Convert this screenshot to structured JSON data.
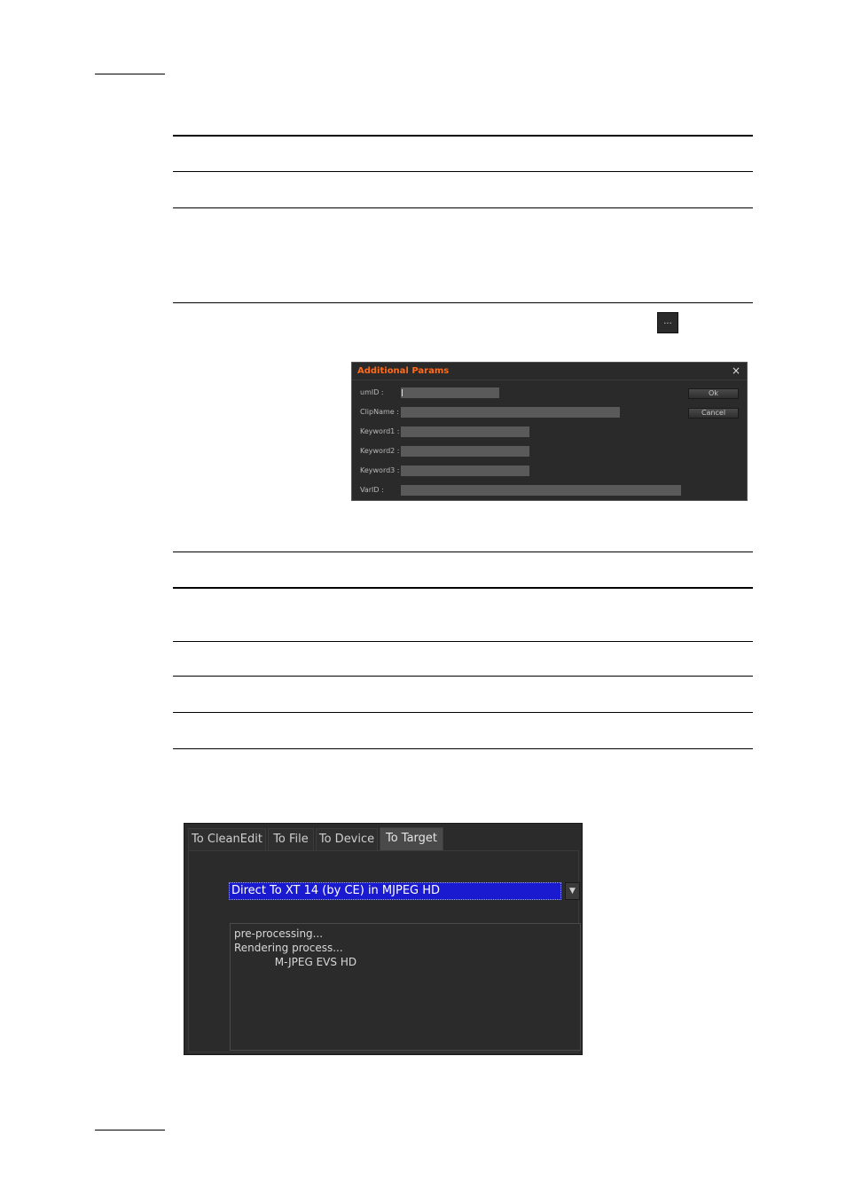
{
  "ellipsis_button": {
    "label": "..."
  },
  "additional_params_dialog": {
    "title": "Additional Params",
    "close_glyph": "×",
    "fields": [
      {
        "label": "umID :",
        "value": ""
      },
      {
        "label": "ClipName :",
        "value": ""
      },
      {
        "label": "Keyword1 :",
        "value": ""
      },
      {
        "label": "Keyword2 :",
        "value": ""
      },
      {
        "label": "Keyword3 :",
        "value": ""
      },
      {
        "label": "VarID :",
        "value": ""
      }
    ],
    "buttons": {
      "ok": "Ok",
      "cancel": "Cancel"
    }
  },
  "output_panel": {
    "tabs": [
      {
        "label": "To CleanEdit",
        "active": false
      },
      {
        "label": "To File",
        "active": false
      },
      {
        "label": "To Device",
        "active": false
      },
      {
        "label": "To Target",
        "active": true
      }
    ],
    "target_select": {
      "selected": "Direct To XT 14 (by CE) in MJPEG HD"
    },
    "dropdown_arrow": "▼",
    "log_lines": [
      "pre-processing...",
      "Rendering process...",
      "            M-JPEG EVS HD"
    ]
  },
  "colors": {
    "dialog_title": "#ff6a1a",
    "selection_highlight": "#1a1ad0",
    "panel_background": "#2b2b2b"
  }
}
